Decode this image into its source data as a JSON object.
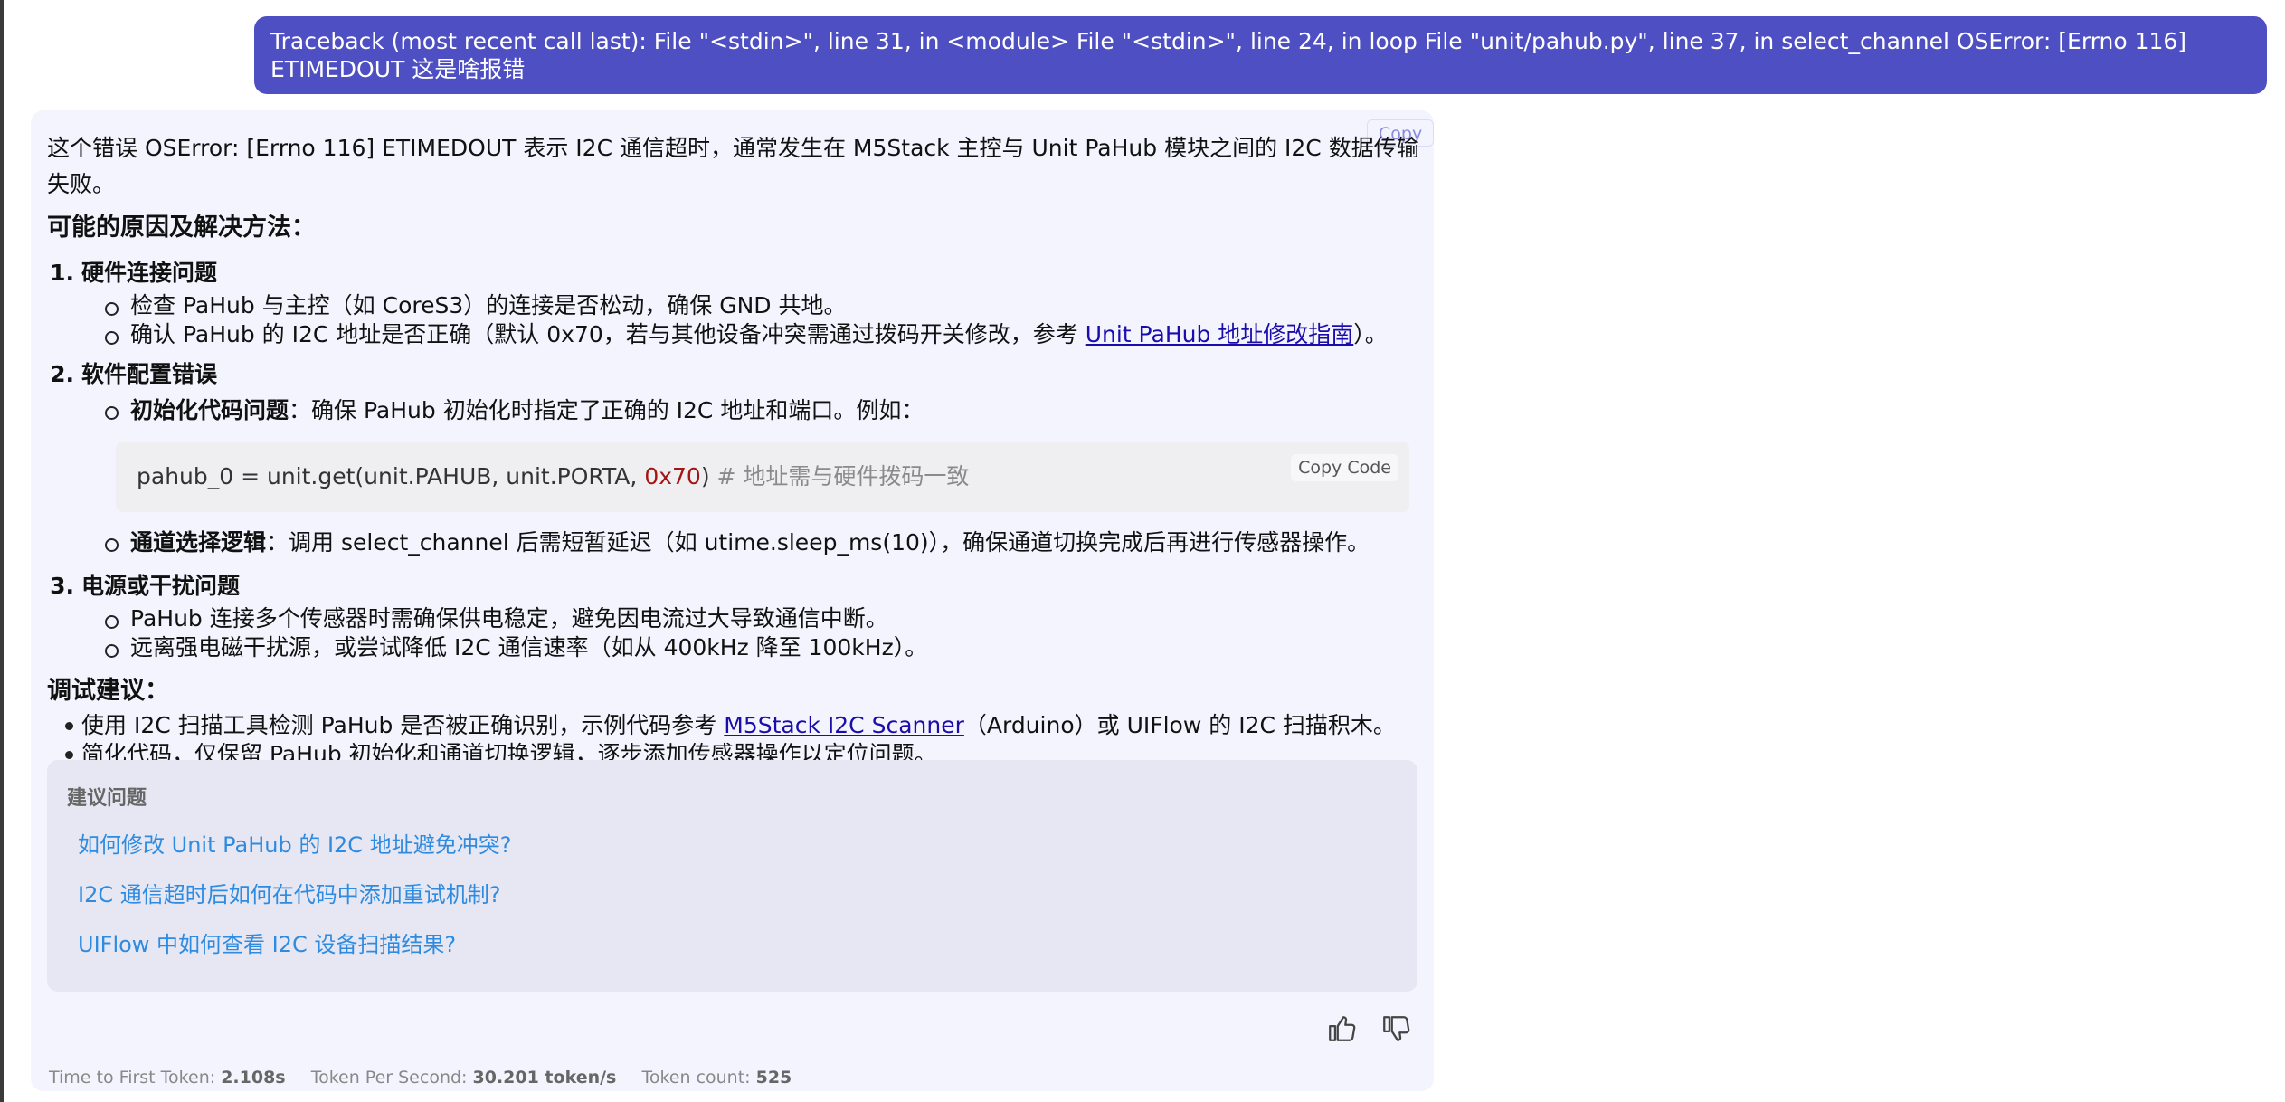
{
  "user_message": "Traceback (most recent call last): File \"<stdin>\", line 31, in <module> File \"<stdin>\", line 24, in loop File \"unit/pahub.py\", line 37, in select_channel OSError: [Errno 116] ETIMEDOUT 这是啥报错",
  "answer": {
    "copy_label": "Copy",
    "intro": "这个错误 OSError: [Errno 116] ETIMEDOUT 表示 I2C 通信超时，通常发生在 M5Stack 主控与 Unit PaHub 模块之间的 I2C 数据传输失败。",
    "causes_heading": "可能的原因及解决方法：",
    "item1": {
      "num": "1.",
      "title": "硬件连接问题",
      "sub1": "检查 PaHub 与主控（如 CoreS3）的连接是否松动，确保 GND 共地。",
      "sub2_prefix": "确认 PaHub 的 I2C 地址是否正确（默认 0x70，若与其他设备冲突需通过拨码开关修改，参考 ",
      "sub2_link": "Unit PaHub 地址修改指南",
      "sub2_suffix": "）。"
    },
    "item2": {
      "num": "2.",
      "title": "软件配置错误",
      "sub1_bold": "初始化代码问题",
      "sub1_text": "：确保 PaHub 初始化时指定了正确的 I2C 地址和端口。例如：",
      "code_main": "pahub_0 = unit.get(unit.PAHUB, unit.PORTA, ",
      "code_num": "0x70",
      "code_close": ")",
      "code_comment": "  # 地址需与硬件拨码一致",
      "copy_code_label": "Copy Code",
      "sub2_bold": "通道选择逻辑",
      "sub2_text": "：调用 select_channel 后需短暂延迟（如 utime.sleep_ms(10)），确保通道切换完成后再进行传感器操作。"
    },
    "item3": {
      "num": "3.",
      "title": "电源或干扰问题",
      "sub1": "PaHub 连接多个传感器时需确保供电稳定，避免因电流过大导致通信中断。",
      "sub2": "远离强电磁干扰源，或尝试降低 I2C 通信速率（如从 400kHz 降至 100kHz）。"
    },
    "debug_heading": "调试建议：",
    "debug1_prefix": "使用 I2C 扫描工具检测 PaHub 是否被正确识别，示例代码参考 ",
    "debug1_link": "M5Stack I2C Scanner",
    "debug1_suffix": "（Arduino）或 UIFlow 的 I2C 扫描积木。",
    "debug2": "简化代码，仅保留 PaHub 初始化和通道切换逻辑，逐步添加传感器操作以定位问题。"
  },
  "suggestions": {
    "title": "建议问题",
    "items": [
      "如何修改 Unit PaHub 的 I2C 地址避免冲突?",
      "I2C 通信超时后如何在代码中添加重试机制?",
      "UIFlow 中如何查看 I2C 设备扫描结果?"
    ]
  },
  "stats": {
    "ttft_label": "Time to First Token:",
    "ttft_value": "2.108s",
    "tps_label": "Token Per Second:",
    "tps_value": "30.201 token/s",
    "count_label": "Token count:",
    "count_value": "525"
  },
  "icons": {
    "like": "thumbs-up-icon",
    "dislike": "thumbs-down-icon"
  }
}
